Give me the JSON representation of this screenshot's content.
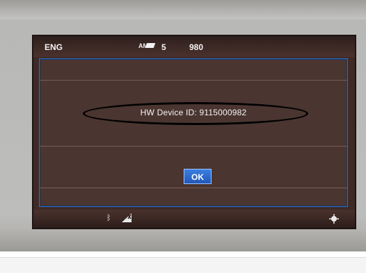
{
  "statusbar": {
    "language": "ENG",
    "band": "AM",
    "preset": "5",
    "frequency": "980"
  },
  "dialog": {
    "message": "HW Device ID: 9115000982",
    "ok_label": "OK"
  },
  "bottombar": {
    "icons": [
      "bluetooth-icon",
      "signal-icon",
      "navigation-icon"
    ]
  },
  "colors": {
    "screen_bg": "#3f2a26",
    "dialog_border": "#2f6fd0",
    "ok_button": "#2f6fd0",
    "annotation": "#000000"
  }
}
